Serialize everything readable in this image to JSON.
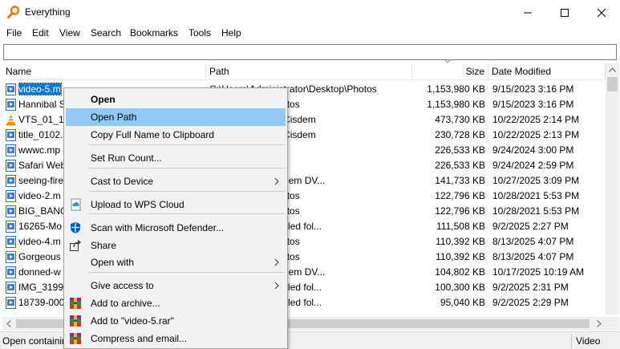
{
  "window": {
    "title": "Everything"
  },
  "menu": [
    "File",
    "Edit",
    "View",
    "Search",
    "Bookmarks",
    "Tools",
    "Help"
  ],
  "search": {
    "value": ""
  },
  "columns": {
    "name": "Name",
    "path": "Path",
    "size": "Size",
    "date": "Date Modified"
  },
  "rows": [
    {
      "name": "video-5.m",
      "path": "C:\\Users\\Administrator\\Desktop\\Photos",
      "size": "1,153,980 KB",
      "date": "9/15/2023 3:16 PM",
      "icon": "video-file-icon"
    },
    {
      "name": "Hannibal S",
      "path": "rator\\Desktop\\Photos",
      "size": "1,153,980 KB",
      "date": "9/15/2023 3:16 PM",
      "icon": "video-file-icon"
    },
    {
      "name": "VTS_01_1.V",
      "path": "rator\\Documents\\Cisdem",
      "size": "473,730 KB",
      "date": "10/22/2025 2:14 PM",
      "icon": "vlc-file-icon"
    },
    {
      "name": "title_0102.",
      "path": "rator\\Documents\\Cisdem",
      "size": "230,728 KB",
      "date": "10/22/2025 2:13 PM",
      "icon": "video-file-icon"
    },
    {
      "name": "wwwc.mp",
      "path": "rator\\Pictures\\D",
      "size": "226,533 KB",
      "date": "9/24/2024 3:00 PM",
      "icon": "video-file-icon"
    },
    {
      "name": "Safari Web",
      "path": "rator\\Pictures\\D",
      "size": "226,533 KB",
      "date": "9/24/2024 2:59 PM",
      "icon": "video-file-icon"
    },
    {
      "name": "seeing-fire",
      "path": "rator\\Pictures\\Cisdem DV...",
      "size": "141,733 KB",
      "date": "10/27/2025 3:09 PM",
      "icon": "video-file-icon"
    },
    {
      "name": "video-2.m",
      "path": "rator\\Desktop\\Photos",
      "size": "122,796 KB",
      "date": "10/28/2021 5:53 PM",
      "icon": "video-file-icon"
    },
    {
      "name": "BIG_BANG",
      "path": "rator\\Desktop\\Photos",
      "size": "122,796 KB",
      "date": "10/28/2021 5:53 PM",
      "icon": "video-file-icon"
    },
    {
      "name": "16265-Mo",
      "path": "rator\\Desktop\\untitled fol...",
      "size": "111,508 KB",
      "date": "9/2/2025 2:27 PM",
      "icon": "video-file-icon"
    },
    {
      "name": "video-4.m",
      "path": "rator\\Desktop\\Photos",
      "size": "110,392 KB",
      "date": "8/13/2025 4:07 PM",
      "icon": "video-file-icon"
    },
    {
      "name": "Gorgeous",
      "path": "rator\\Desktop\\Photos",
      "size": "110,392 KB",
      "date": "8/13/2025 4:07 PM",
      "icon": "video-file-icon"
    },
    {
      "name": "donned-w",
      "path": "rator\\Pictures\\Cisdem DV...",
      "size": "104,802 KB",
      "date": "10/17/2025 10:19 AM",
      "icon": "video-file-icon"
    },
    {
      "name": "IMG_3199_",
      "path": "rator\\Desktop\\untitled fol...",
      "size": "100,300 KB",
      "date": "9/2/2025 2:31 PM",
      "icon": "video-file-icon"
    },
    {
      "name": "18739-000",
      "path": "rator\\Desktop\\untitled fol...",
      "size": "95,040 KB",
      "date": "9/2/2025 2:29 PM",
      "icon": "video-file-icon"
    }
  ],
  "status": {
    "left": "Open containing",
    "right": "Video"
  },
  "context_menu": {
    "items": [
      {
        "label": "Open",
        "bold": true
      },
      {
        "label": "Open Path",
        "highlighted": true
      },
      {
        "label": "Copy Full Name to Clipboard"
      },
      {
        "label": "Set Run Count..."
      },
      {
        "label": "Cast to Device",
        "submenu": true
      },
      {
        "label": "Upload to WPS Cloud",
        "icon": "wps-cloud-icon"
      },
      {
        "label": "Scan with Microsoft Defender...",
        "icon": "defender-shield-icon"
      },
      {
        "label": "Share",
        "icon": "share-icon"
      },
      {
        "label": "Open with",
        "submenu": true
      },
      {
        "label": "Give access to",
        "submenu": true
      },
      {
        "label": "Add to archive...",
        "icon": "winrar-icon"
      },
      {
        "label": "Add to \"video-5.rar\"",
        "icon": "winrar-icon"
      },
      {
        "label": "Compress and email...",
        "icon": "winrar-icon"
      }
    ]
  },
  "colors": {
    "selection": "#0078d7",
    "menu_highlight": "#91c9f7",
    "app_icon": "#e8740c"
  }
}
